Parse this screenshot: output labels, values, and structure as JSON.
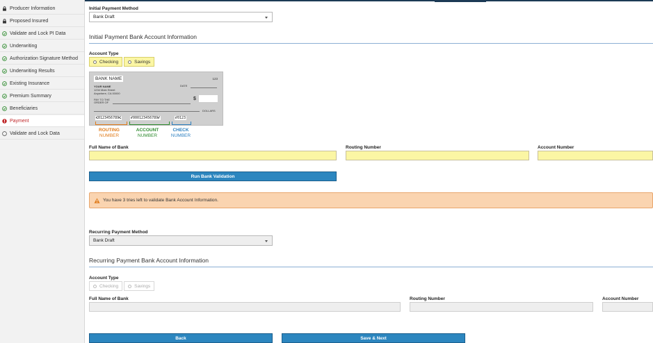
{
  "sidebar": {
    "items": [
      {
        "label": "Producer Information",
        "status": "lock"
      },
      {
        "label": "Proposed Insured",
        "status": "lock"
      },
      {
        "label": "Validate and Lock PI Data",
        "status": "done"
      },
      {
        "label": "Underwriting",
        "status": "done"
      },
      {
        "label": "Authorization Signature Method",
        "status": "done"
      },
      {
        "label": "Underwriting Results",
        "status": "done"
      },
      {
        "label": "Existing Insurance",
        "status": "done"
      },
      {
        "label": "Premium Summary",
        "status": "done"
      },
      {
        "label": "Beneficiaries",
        "status": "done"
      },
      {
        "label": "Payment",
        "status": "error",
        "active": true
      },
      {
        "label": "Validate and Lock Data",
        "status": "empty"
      }
    ]
  },
  "initial": {
    "method_label": "Initial Payment Method",
    "method_value": "Bank Draft",
    "section_title": "Initial Payment Bank Account Information",
    "account_type_label": "Account Type",
    "checking": "Checking",
    "savings": "Savings",
    "full_name_label": "Full Name of Bank",
    "routing_label": "Routing Number",
    "account_label": "Account Number",
    "validate_button": "Run Bank Validation",
    "alert": "You have 3 tries left to validate Bank Account Information."
  },
  "check": {
    "bank_name": "BANK NAME",
    "check_no": "123",
    "your_name": "YOUR NAME",
    "street": "1234 Main Street",
    "city": "Anywhere, CA 00000",
    "date": "DATE",
    "pay_to": "PAY TO THE",
    "order_of": "ORDER OF",
    "dollar": "$",
    "dollars": "DOLLARS",
    "micr_routing": "⑆0123456789⑆",
    "micr_account": "⑈000123456789⑈",
    "micr_check": "⑈0123",
    "routing_top": "ROUTING",
    "account_top": "ACCOUNT",
    "check_top": "CHECK",
    "number": "NUMBER"
  },
  "recurring": {
    "method_label": "Recurring Payment Method",
    "method_value": "Bank Draft",
    "section_title": "Recurring Payment Bank Account Information",
    "account_type_label": "Account Type",
    "checking": "Checking",
    "savings": "Savings",
    "full_name_label": "Full Name of Bank",
    "routing_label": "Routing Number",
    "account_label": "Account Number"
  },
  "footer": {
    "back": "Back",
    "save_next": "Save & Next"
  },
  "colors": {
    "accent": "#2c86bf",
    "required_field": "#fbf6a4",
    "alert_bg": "#fad4b0",
    "routing": "#e07b1a",
    "account": "#2e8b2e",
    "check": "#2c7fc0"
  }
}
